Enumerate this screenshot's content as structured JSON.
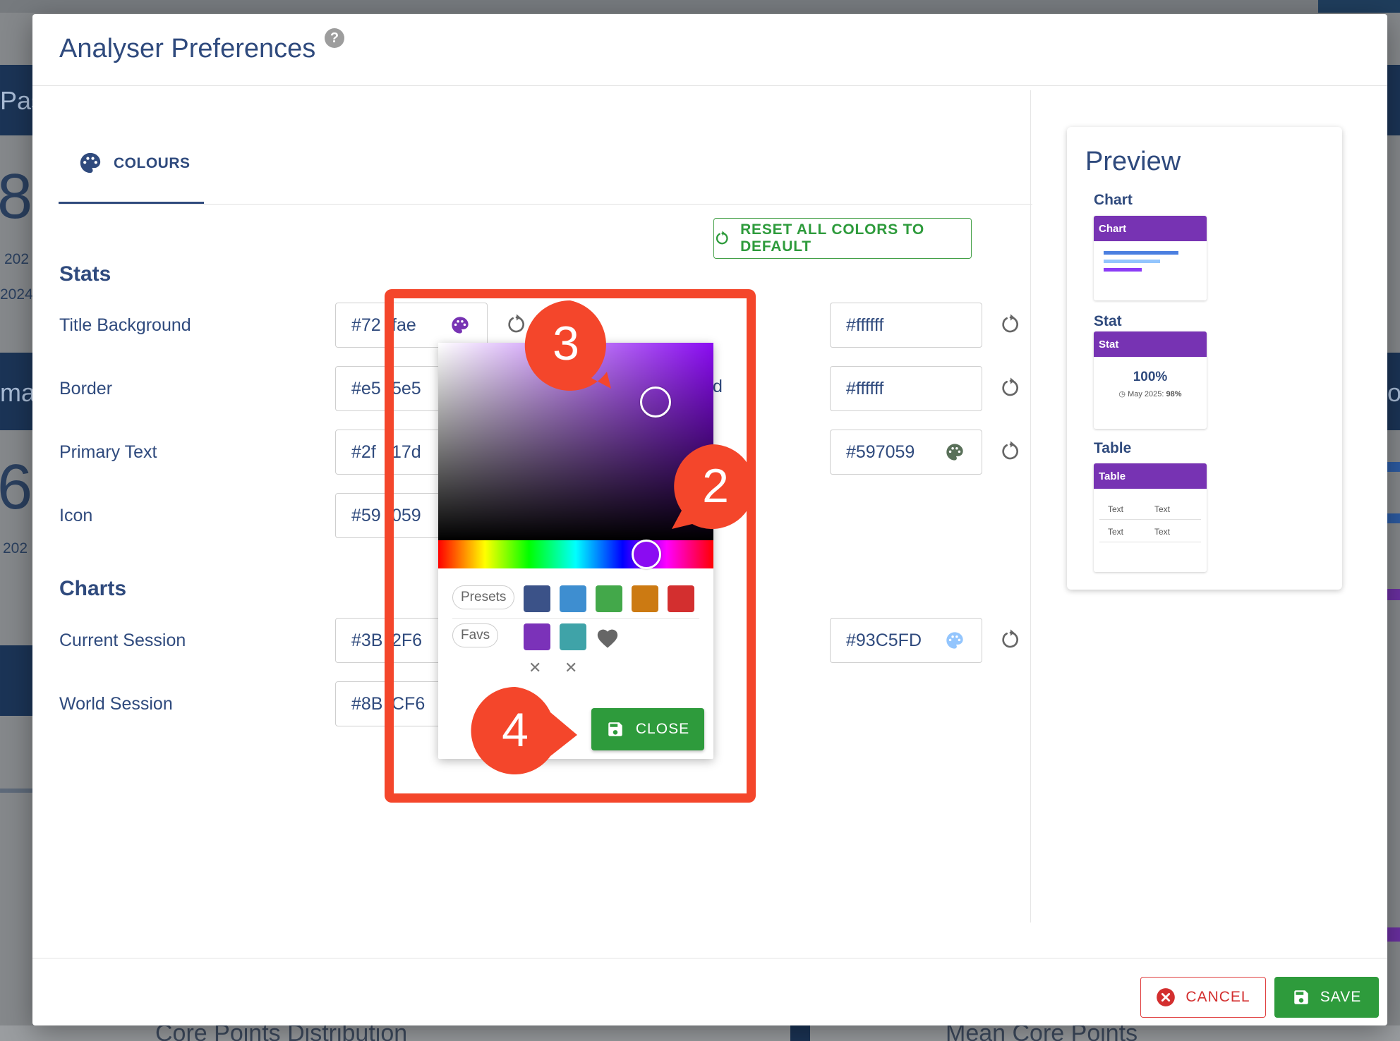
{
  "background": {
    "texts": [
      "Pas",
      "8",
      "202",
      "2024",
      "ma",
      "6",
      "202",
      "o",
      "Core Points Distribution",
      "Mean Core Points"
    ]
  },
  "dialog": {
    "title": "Analyser Preferences",
    "tab_label": "COLOURS",
    "reset_all_label": "RESET ALL COLORS TO DEFAULT",
    "sections": {
      "stats": "Stats",
      "charts": "Charts"
    },
    "rows": {
      "title_background": {
        "label": "Title Background",
        "left": "#72",
        "left_tail": "fae",
        "right": "#ffffff"
      },
      "border": {
        "label": "Border",
        "left": "#e5",
        "left_tail": "5e5",
        "right": "#ffffff",
        "mid_glyph": "d"
      },
      "primary_text": {
        "label": "Primary Text",
        "left": "#2f",
        "left_tail": "17d",
        "right": "#597059"
      },
      "icon": {
        "label": "Icon",
        "left": "#59",
        "left_tail": "059"
      },
      "current_session": {
        "label": "Current Session",
        "left": "#3B",
        "left_tail": "2F6",
        "right": "#93C5FD"
      },
      "world_session": {
        "label": "World Session",
        "left": "#8B",
        "left_tail": "CF6"
      }
    },
    "cancel_label": "CANCEL",
    "save_label": "SAVE"
  },
  "preview": {
    "title": "Preview",
    "chart": {
      "label": "Chart",
      "header": "Chart"
    },
    "stat": {
      "label": "Stat",
      "header": "Stat",
      "value": "100%",
      "caption": "May 2025:",
      "caption_value": "98%"
    },
    "table": {
      "label": "Table",
      "header": "Table",
      "cells": [
        [
          "Text",
          "Text"
        ],
        [
          "Text",
          "Text"
        ]
      ]
    }
  },
  "picker": {
    "selected_color": "#8a0cf2",
    "presets_label": "Presets",
    "presets": [
      "#3b5288",
      "#3e8ed0",
      "#43a84a",
      "#cc7a12",
      "#d32f2f"
    ],
    "favs_label": "Favs",
    "favs": [
      "#7b32b9",
      "#3fa3a8"
    ],
    "close_label": "CLOSE"
  },
  "callouts": {
    "c2": "2",
    "c3": "3",
    "c4": "4"
  },
  "colors": {
    "primary": "#2f4a7d",
    "accent_green": "#2e9b3c",
    "callout": "#f4462b",
    "danger": "#d32f2f",
    "purple": "#7733b3"
  }
}
